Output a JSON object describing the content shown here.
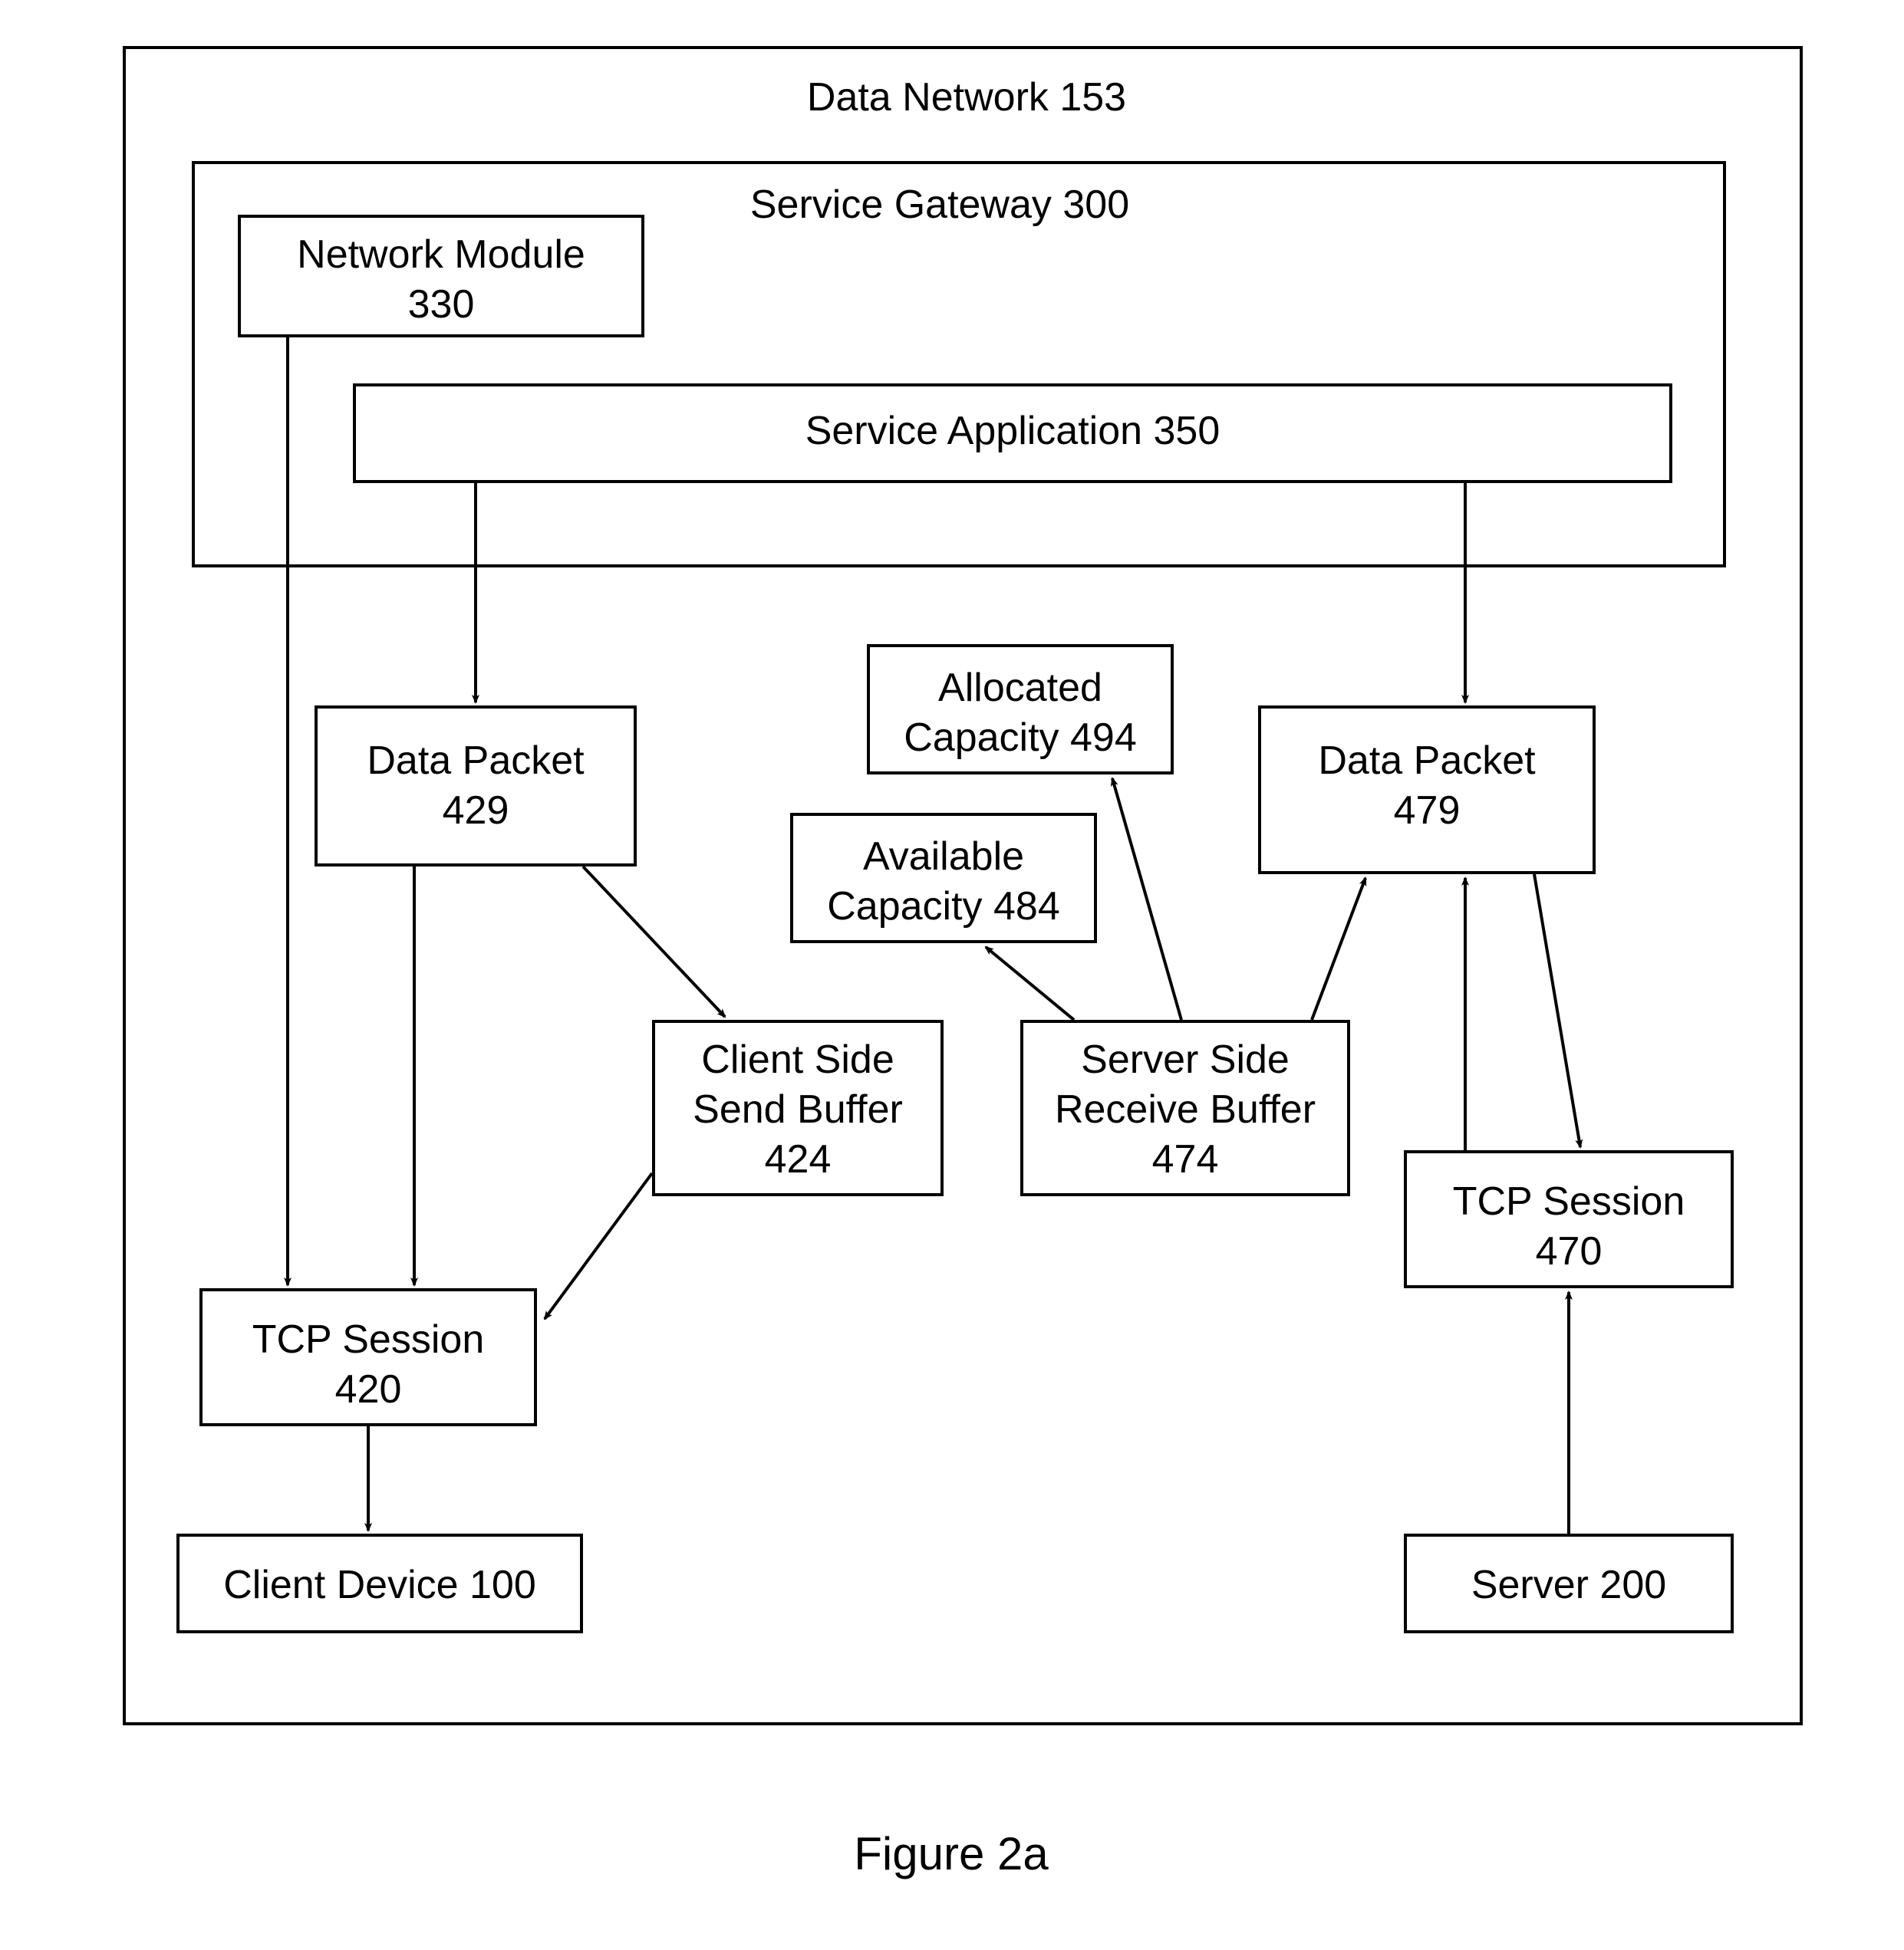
{
  "figure_caption": "Figure 2a",
  "outer": {
    "label": "Data Network 153"
  },
  "gateway": {
    "label": "Service Gateway 300"
  },
  "network_module": {
    "label": "Network Module\n330"
  },
  "service_app": {
    "label": "Service Application 350"
  },
  "data_packet_429": {
    "label": "Data Packet\n429"
  },
  "allocated_capacity": {
    "label": "Allocated\nCapacity 494"
  },
  "available_capacity": {
    "label": "Available\nCapacity 484"
  },
  "data_packet_479": {
    "label": "Data Packet\n479"
  },
  "client_send_buffer": {
    "label": "Client Side\nSend Buffer\n424"
  },
  "server_recv_buffer": {
    "label": "Server Side\nReceive Buffer\n474"
  },
  "tcp_420": {
    "label": "TCP Session\n420"
  },
  "tcp_470": {
    "label": "TCP Session\n470"
  },
  "client_device": {
    "label": "Client Device 100"
  },
  "server": {
    "label": "Server 200"
  }
}
